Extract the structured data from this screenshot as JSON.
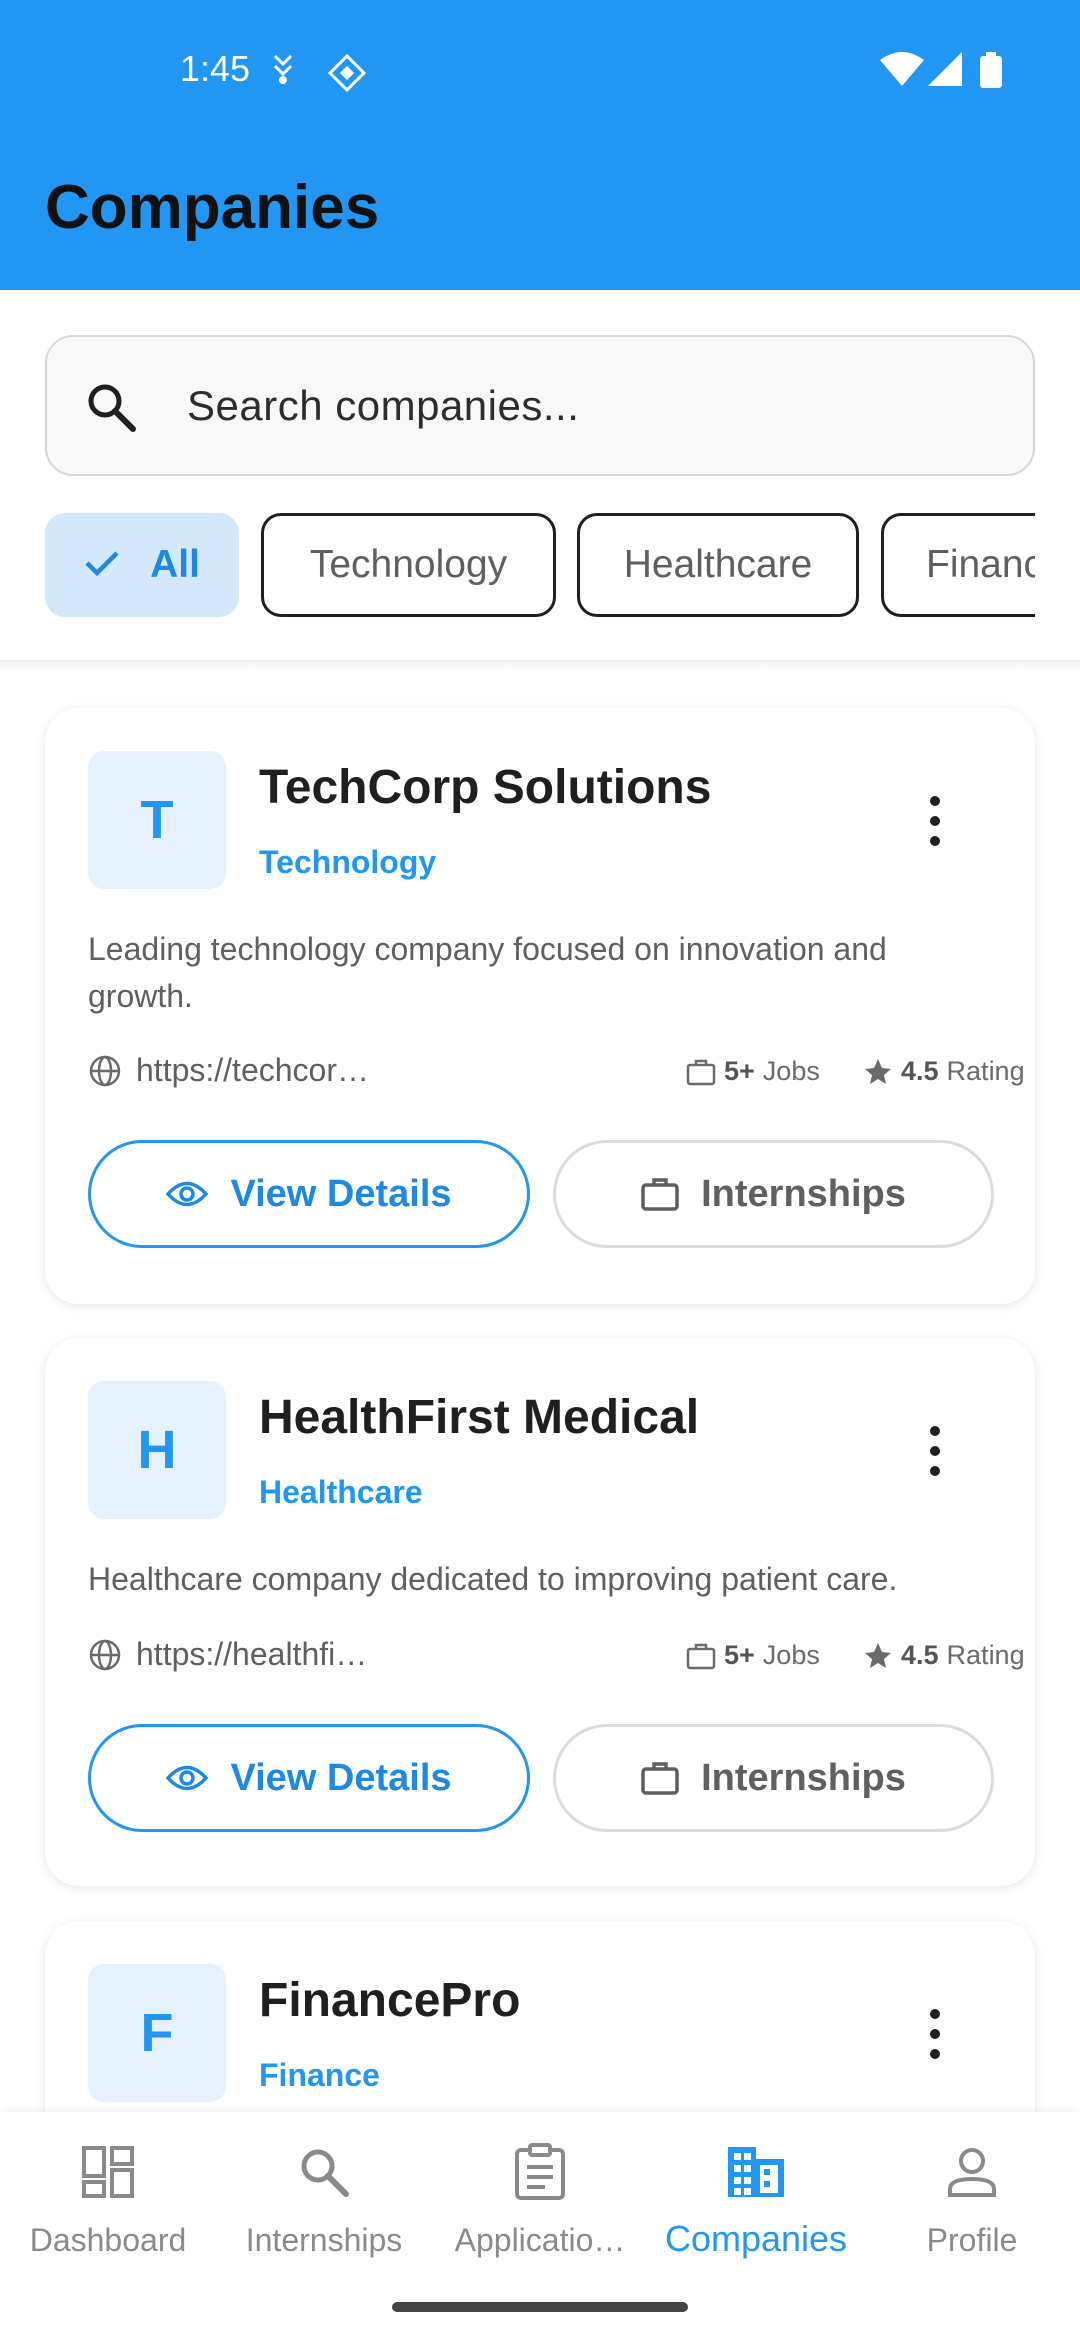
{
  "status_bar": {
    "time": "1:45"
  },
  "header": {
    "title": "Companies"
  },
  "search": {
    "placeholder": "Search companies..."
  },
  "filters": [
    {
      "label": "All",
      "selected": true
    },
    {
      "label": "Technology",
      "selected": false
    },
    {
      "label": "Healthcare",
      "selected": false
    },
    {
      "label": "Financ",
      "selected": false
    }
  ],
  "companies": [
    {
      "initial": "T",
      "name": "TechCorp Solutions",
      "industry": "Technology",
      "description": "Leading technology company focused on innovation and growth.",
      "website": "https://techcor…",
      "jobs_value": "5+",
      "jobs_label": "Jobs",
      "rating_value": "4.5",
      "rating_label": "Rating",
      "view_label": "View Details",
      "internships_label": "Internships"
    },
    {
      "initial": "H",
      "name": "HealthFirst Medical",
      "industry": "Healthcare",
      "description": "Healthcare company dedicated to improving patient care.",
      "website": "https://healthfi…",
      "jobs_value": "5+",
      "jobs_label": "Jobs",
      "rating_value": "4.5",
      "rating_label": "Rating",
      "view_label": "View Details",
      "internships_label": "Internships"
    },
    {
      "initial": "F",
      "name": "FinancePro",
      "industry": "Finance"
    }
  ],
  "bottom_nav": [
    {
      "label": "Dashboard",
      "icon": "dashboard-icon",
      "active": false
    },
    {
      "label": "Internships",
      "icon": "search-icon",
      "active": false
    },
    {
      "label": "Applicatio…",
      "icon": "clipboard-icon",
      "active": false
    },
    {
      "label": "Companies",
      "icon": "building-icon",
      "active": true
    },
    {
      "label": "Profile",
      "icon": "person-icon",
      "active": false
    }
  ],
  "colors": {
    "primary": "#2196F3",
    "chip_selected_bg": "#d4e8fb",
    "avatar_bg": "#e5f2fd"
  }
}
